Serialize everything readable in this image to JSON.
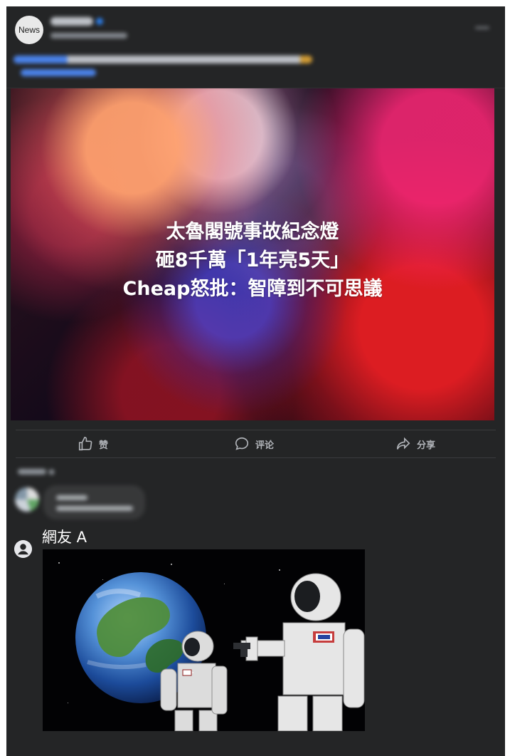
{
  "post": {
    "avatar_text": "News",
    "headline_lines": [
      "太魯閣號事故紀念燈",
      "砸8千萬「1年亮5天」",
      "Cheap怒批：智障到不可思議"
    ]
  },
  "actions": {
    "like": "赞",
    "comment": "评论",
    "share": "分享"
  },
  "comments": [
    {
      "author": "網友 A"
    }
  ],
  "colors": {
    "background": "#242526",
    "text": "#e4e6eb",
    "muted": "#b0b3b8",
    "accent": "#2d88ff"
  },
  "icons": {
    "like": "thumbs-up-icon",
    "comment": "speech-bubble-icon",
    "share": "share-arrow-icon",
    "user": "user-icon"
  }
}
